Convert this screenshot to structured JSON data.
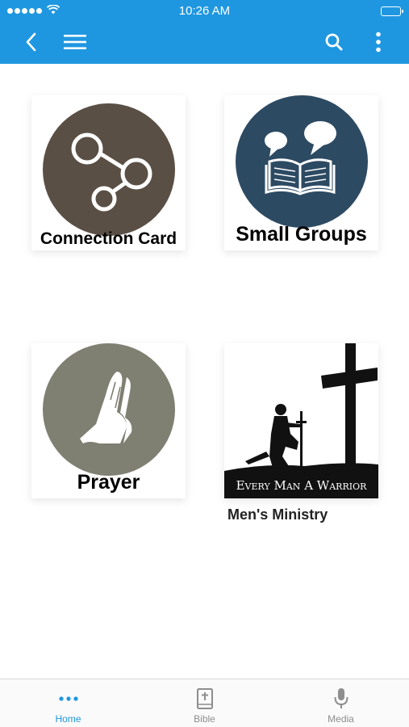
{
  "status_bar": {
    "time": "10:26 AM"
  },
  "nav": {
    "back_icon": "chevron-left-icon",
    "menu_icon": "hamburger-icon",
    "search_icon": "search-icon",
    "more_icon": "more-vertical-icon",
    "background_color": "#1f97e0"
  },
  "tiles": [
    {
      "caption": "Connection Card",
      "icon": "share-nodes-icon",
      "circle_color": "#5a4f45"
    },
    {
      "caption": "Small Groups",
      "icon": "bible-chat-icon",
      "circle_color": "#2d4a63"
    },
    {
      "caption": "Prayer",
      "icon": "praying-hands-icon",
      "circle_color": "#7f7f72"
    },
    {
      "banner_text": "Every Man A Warrior",
      "label": "Men's Ministry",
      "icon": "kneeling-warrior-cross-image"
    }
  ],
  "tabbar": {
    "tabs": [
      {
        "label": "Home",
        "icon": "dots-icon",
        "active": true
      },
      {
        "label": "Bible",
        "icon": "bible-icon",
        "active": false
      },
      {
        "label": "Media",
        "icon": "microphone-icon",
        "active": false
      }
    ]
  }
}
